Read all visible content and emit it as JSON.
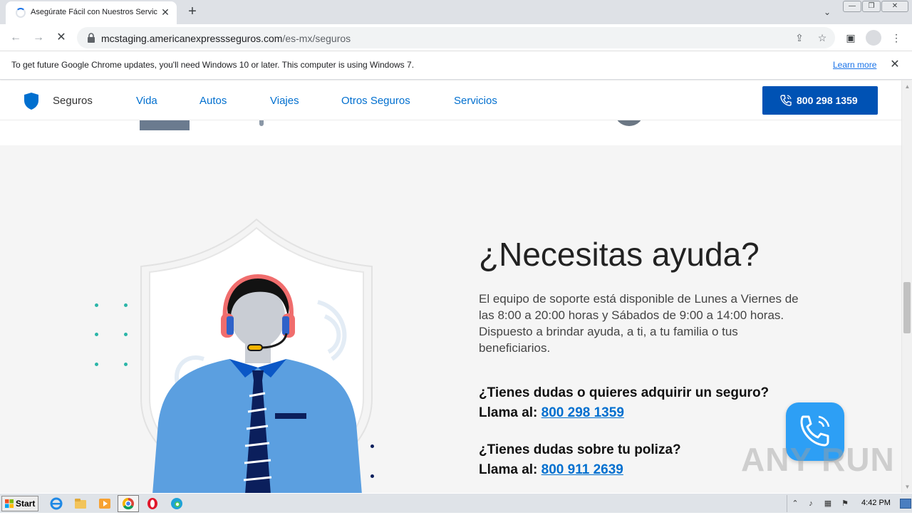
{
  "browser": {
    "tab_title": "Asegúrate Fácil con Nuestros Servicios",
    "url_host": "mcstaging.americanexpressseguros.com",
    "url_path": "/es-mx/seguros"
  },
  "infobar": {
    "message": "To get future Google Chrome updates, you'll need Windows 10 or later. This computer is using Windows 7.",
    "link_label": "Learn more"
  },
  "site": {
    "brand_label": "Seguros",
    "nav_items": [
      "Vida",
      "Autos",
      "Viajes",
      "Otros Seguros",
      "Servicios"
    ],
    "phone_button_label": "800 298 1359"
  },
  "help": {
    "title": "¿Necesitas ayuda?",
    "description": "El equipo de soporte está disponible de Lunes a Viernes de las 8:00 a 20:00 horas y Sábados de 9:00 a 14:00 horas. Dispuesto a brindar ayuda, a ti, a tu familia o tus beneficiarios.",
    "contacts": [
      {
        "question": "¿Tienes dudas o quieres adquirir un seguro?",
        "call_label": "Llama al:",
        "phone": "800 298 1359"
      },
      {
        "question": "¿Tienes dudas sobre tu poliza?",
        "call_label": "Llama al:",
        "phone": "800 911 2639"
      }
    ]
  },
  "watermark": "ANY RUN",
  "taskbar": {
    "start_label": "Start",
    "clock": "4:42 PM"
  },
  "colors": {
    "brand_blue": "#0052b4",
    "link_blue": "#006fcf",
    "accent_teal": "#2bb5a8",
    "dot_navy": "#0b1f5c"
  }
}
